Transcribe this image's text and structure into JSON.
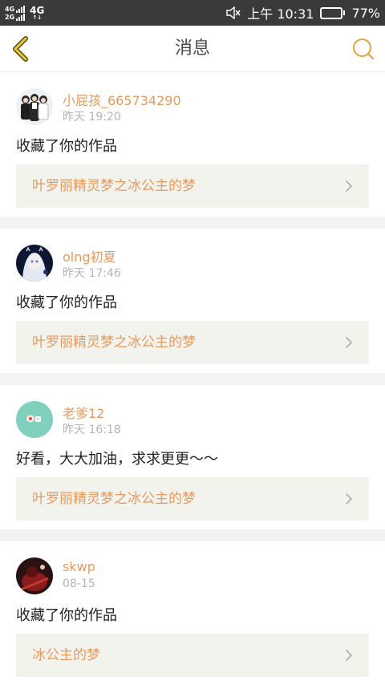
{
  "status_bar": {
    "signal_top": "4G",
    "signal_bottom": "2G",
    "network": "4G",
    "time": "上午 10:31",
    "battery": "77%",
    "battery_level": 0.77,
    "battery_color": "#22c55e"
  },
  "nav": {
    "title": "消息",
    "back_icon": "chevron-left-icon",
    "search_icon": "search-icon",
    "accent": "#e6a23c"
  },
  "colors": {
    "username": "#e79a5e",
    "work_title": "#e79a5e",
    "link_bg": "#f3f3ed",
    "separator": "#f3f3f1"
  },
  "messages": [
    {
      "username": "小屁孩_665734290",
      "time": "昨天 19:20",
      "action": "收藏了你的作品",
      "work_title": "叶罗丽精灵梦之冰公主的梦",
      "avatar": "group-photo-avatar"
    },
    {
      "username": "olng初夏",
      "time": "昨天 17:46",
      "action": "收藏了你的作品",
      "work_title": "叶罗丽精灵梦之冰公主的梦",
      "avatar": "anime-girl-avatar"
    },
    {
      "username": "老爹12",
      "time": "昨天 16:18",
      "action": "好看，大大加油，求求更更～～",
      "work_title": "叶罗丽精灵梦之冰公主的梦",
      "avatar": "teal-cartoon-avatar"
    },
    {
      "username": "skwp",
      "time": "08-15",
      "action": "收藏了你的作品",
      "work_title": "冰公主的梦",
      "avatar": "dark-red-avatar"
    }
  ]
}
